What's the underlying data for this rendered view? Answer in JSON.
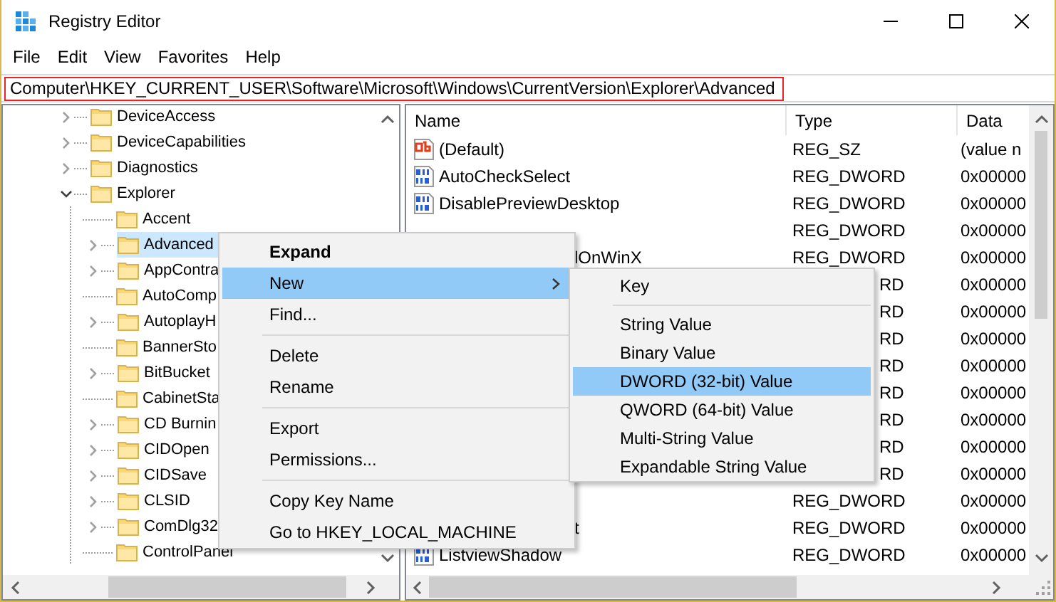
{
  "window": {
    "title": "Registry Editor"
  },
  "menu_bar": [
    "File",
    "Edit",
    "View",
    "Favorites",
    "Help"
  ],
  "address_bar": {
    "value": "Computer\\HKEY_CURRENT_USER\\Software\\Microsoft\\Windows\\CurrentVersion\\Explorer\\Advanced"
  },
  "tree": {
    "items": [
      {
        "label": "DeviceAccess",
        "has_children": true,
        "expanded": false,
        "selected": false
      },
      {
        "label": "DeviceCapabilities",
        "has_children": true,
        "expanded": false,
        "selected": false
      },
      {
        "label": "Diagnostics",
        "has_children": true,
        "expanded": false,
        "selected": false
      },
      {
        "label": "Explorer",
        "has_children": true,
        "expanded": true,
        "selected": false,
        "children": [
          {
            "label": "Accent",
            "has_children": false,
            "selected": false
          },
          {
            "label": "Advanced",
            "has_children": true,
            "expanded": false,
            "selected": true
          },
          {
            "label": "AppContra",
            "has_children": true,
            "expanded": false,
            "selected": false
          },
          {
            "label": "AutoComp",
            "has_children": false,
            "selected": false
          },
          {
            "label": "AutoplayH",
            "has_children": true,
            "expanded": false,
            "selected": false
          },
          {
            "label": "BannerSto",
            "has_children": false,
            "selected": false
          },
          {
            "label": "BitBucket",
            "has_children": true,
            "expanded": false,
            "selected": false
          },
          {
            "label": "CabinetSta",
            "has_children": false,
            "selected": false
          },
          {
            "label": "CD Burnin",
            "has_children": true,
            "expanded": false,
            "selected": false
          },
          {
            "label": "CIDOpen",
            "has_children": true,
            "expanded": false,
            "selected": false
          },
          {
            "label": "CIDSave",
            "has_children": true,
            "expanded": false,
            "selected": false
          },
          {
            "label": "CLSID",
            "has_children": true,
            "expanded": false,
            "selected": false
          },
          {
            "label": "ComDlg32",
            "has_children": true,
            "expanded": false,
            "selected": false
          },
          {
            "label": "ControlPanel",
            "has_children": false,
            "selected": false
          }
        ]
      }
    ]
  },
  "values": {
    "columns": [
      "Name",
      "Type",
      "Data"
    ],
    "rows": [
      {
        "kind": "string",
        "name": "(Default)",
        "type": "REG_SZ",
        "data": "(value n"
      },
      {
        "kind": "dword",
        "name": "AutoCheckSelect",
        "type": "REG_DWORD",
        "data": "0x00000"
      },
      {
        "kind": "dword",
        "name": "DisablePreviewDesktop",
        "type": "REG_DWORD",
        "data": "0x00000"
      },
      {
        "kind": "covered",
        "type": "REG_DWORD",
        "data": "0x00000"
      },
      {
        "kind": "covered",
        "name": "lOnWinX",
        "type": "REG_DWORD",
        "data": "0x00000"
      },
      {
        "kind": "submenu_covered",
        "type": "RD",
        "data": "0x00000"
      },
      {
        "kind": "submenu_covered",
        "type": "RD",
        "data": "0x00000"
      },
      {
        "kind": "submenu_covered",
        "type": "RD",
        "data": "0x00000"
      },
      {
        "kind": "submenu_covered",
        "type": "RD",
        "data": "0x00000"
      },
      {
        "kind": "submenu_covered",
        "type": "RD",
        "data": "0x00000"
      },
      {
        "kind": "submenu_covered",
        "type": "RD",
        "data": "0x00000"
      },
      {
        "kind": "submenu_covered",
        "type": "RD",
        "data": "0x00000"
      },
      {
        "kind": "submenu_covered",
        "type": "RD",
        "data": "0x00000"
      },
      {
        "kind": "covered",
        "type": "REG_DWORD",
        "data": "0x00000"
      },
      {
        "kind": "covered",
        "name": "t",
        "type": "REG_DWORD",
        "data": "0x00000"
      },
      {
        "kind": "dword",
        "name": "ListviewShadow",
        "type": "REG_DWORD",
        "data": "0x00000"
      }
    ]
  },
  "context_menu": {
    "items": [
      {
        "kind": "item",
        "label": "Expand",
        "default": true,
        "submenu": false,
        "selected": false
      },
      {
        "kind": "item",
        "label": "New",
        "default": false,
        "submenu": true,
        "selected": true
      },
      {
        "kind": "item",
        "label": "Find...",
        "default": false,
        "submenu": false,
        "selected": false
      },
      {
        "kind": "separator"
      },
      {
        "kind": "item",
        "label": "Delete",
        "default": false,
        "submenu": false,
        "selected": false
      },
      {
        "kind": "item",
        "label": "Rename",
        "default": false,
        "submenu": false,
        "selected": false
      },
      {
        "kind": "separator"
      },
      {
        "kind": "item",
        "label": "Export",
        "default": false,
        "submenu": false,
        "selected": false
      },
      {
        "kind": "item",
        "label": "Permissions...",
        "default": false,
        "submenu": false,
        "selected": false
      },
      {
        "kind": "separator"
      },
      {
        "kind": "item",
        "label": "Copy Key Name",
        "default": false,
        "submenu": false,
        "selected": false
      },
      {
        "kind": "item",
        "label": "Go to HKEY_LOCAL_MACHINE",
        "default": false,
        "submenu": false,
        "selected": false
      }
    ]
  },
  "submenu": {
    "items": [
      {
        "kind": "item",
        "label": "Key",
        "default": false,
        "submenu": false,
        "selected": false
      },
      {
        "kind": "separator"
      },
      {
        "kind": "item",
        "label": "String Value",
        "default": false,
        "submenu": false,
        "selected": false
      },
      {
        "kind": "item",
        "label": "Binary Value",
        "default": false,
        "submenu": false,
        "selected": false
      },
      {
        "kind": "item",
        "label": "DWORD (32-bit) Value",
        "default": false,
        "submenu": false,
        "selected": true
      },
      {
        "kind": "item",
        "label": "QWORD (64-bit) Value",
        "default": false,
        "submenu": false,
        "selected": false
      },
      {
        "kind": "item",
        "label": "Multi-String Value",
        "default": false,
        "submenu": false,
        "selected": false
      },
      {
        "kind": "item",
        "label": "Expandable String Value",
        "default": false,
        "submenu": false,
        "selected": false
      }
    ]
  }
}
